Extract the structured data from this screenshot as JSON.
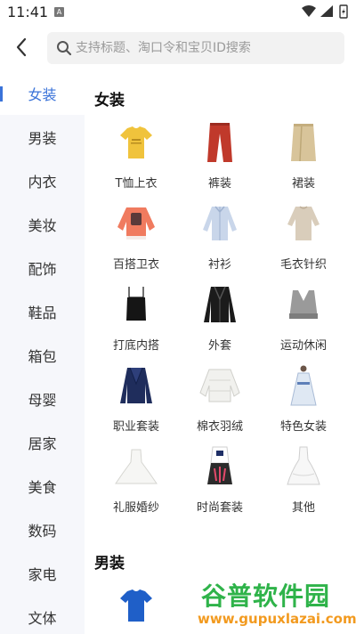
{
  "status_bar": {
    "time": "11:41",
    "notice_glyph": "A"
  },
  "header": {
    "back_icon": "chevron-left-icon",
    "search_placeholder": "支持标题、淘口令和宝贝ID搜索"
  },
  "colors": {
    "accent": "#3a73d9",
    "sidebar_bg": "#f6f7fb"
  },
  "sidebar": {
    "items": [
      {
        "label": "女装",
        "active": true
      },
      {
        "label": "男装"
      },
      {
        "label": "内衣"
      },
      {
        "label": "美妆"
      },
      {
        "label": "配饰"
      },
      {
        "label": "鞋品"
      },
      {
        "label": "箱包"
      },
      {
        "label": "母婴"
      },
      {
        "label": "居家"
      },
      {
        "label": "美食"
      },
      {
        "label": "数码"
      },
      {
        "label": "家电"
      },
      {
        "label": "文体"
      }
    ]
  },
  "sections": [
    {
      "title": "女装",
      "items": [
        {
          "label": "T恤上衣",
          "icon": "yellow-tshirt-icon"
        },
        {
          "label": "裤装",
          "icon": "red-trousers-icon"
        },
        {
          "label": "裙装",
          "icon": "beige-skirt-icon"
        },
        {
          "label": "百搭卫衣",
          "icon": "pink-sweatshirt-icon"
        },
        {
          "label": "衬衫",
          "icon": "striped-shirt-icon"
        },
        {
          "label": "毛衣针织",
          "icon": "beige-sweater-icon"
        },
        {
          "label": "打底内搭",
          "icon": "black-camisole-icon"
        },
        {
          "label": "外套",
          "icon": "leather-jacket-icon"
        },
        {
          "label": "运动休闲",
          "icon": "sports-bra-icon"
        },
        {
          "label": "职业套装",
          "icon": "navy-blazer-icon"
        },
        {
          "label": "棉衣羽绒",
          "icon": "white-down-jacket-icon"
        },
        {
          "label": "特色女装",
          "icon": "hanfu-dress-icon"
        },
        {
          "label": "礼服婚纱",
          "icon": "wedding-dress-icon"
        },
        {
          "label": "时尚套装",
          "icon": "fashion-outfit-icon"
        },
        {
          "label": "其他",
          "icon": "white-gown-icon"
        }
      ]
    },
    {
      "title": "男装",
      "items": [
        {
          "label": "",
          "icon": "blue-tshirt-icon"
        }
      ]
    }
  ],
  "watermark": {
    "line1": "谷普软件园",
    "line2": "www.gupuxlazai.com"
  }
}
